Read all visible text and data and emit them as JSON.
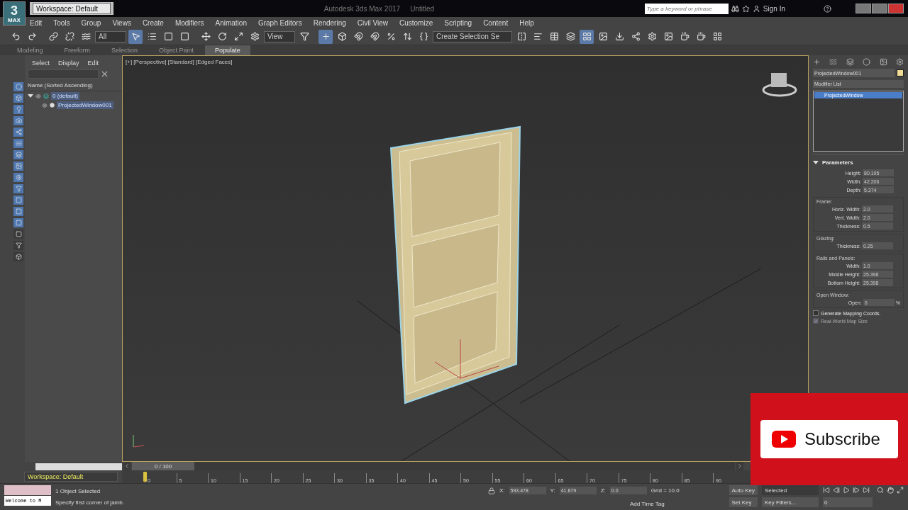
{
  "title_bar": {
    "app_button": {
      "digit": "3",
      "label": "MAX"
    },
    "workspace": "Workspace: Default",
    "title": "Autodesk 3ds Max 2017",
    "document": "Untitled",
    "search": {
      "placeholder": "Type a keyword or phrase"
    },
    "sign_in": "Sign In"
  },
  "menu": [
    "Edit",
    "Tools",
    "Group",
    "Views",
    "Create",
    "Modifiers",
    "Animation",
    "Graph Editors",
    "Rendering",
    "Civil View",
    "Customize",
    "Scripting",
    "Content",
    "Help"
  ],
  "toolbar": {
    "filter": "All",
    "reference": "View",
    "selection_set": "Create Selection Se"
  },
  "ribbon_tabs": [
    {
      "label": "Modeling",
      "selected": false
    },
    {
      "label": "Freeform",
      "selected": false
    },
    {
      "label": "Selection",
      "selected": false
    },
    {
      "label": "Object Paint",
      "selected": false
    },
    {
      "label": "Populate",
      "selected": true
    }
  ],
  "scene_explorer": {
    "tabs": [
      "Select",
      "Display",
      "Edit"
    ],
    "column": "Name (Sorted Ascending)",
    "tree": [
      {
        "label": "0 (default)",
        "expanded": true,
        "selected": true,
        "children": [
          {
            "label": "ProjectedWindow001",
            "selected": true
          }
        ]
      }
    ]
  },
  "viewport": {
    "label": "[+] [Perspective] [Standard] [Edged Faces]"
  },
  "command_panel": {
    "object_name": "ProjectedWindow001",
    "object_swatch": {
      "color": "#f0dc96"
    },
    "modifier_list": "Modifier List",
    "stack": [
      {
        "label": "ProjectedWindow",
        "selected": true
      }
    ],
    "rollout": {
      "title": "Parameters",
      "expanded": true,
      "groups": [
        {
          "rows": [
            {
              "label": "Height:",
              "value": "80.195"
            },
            {
              "label": "Width:",
              "value": "42.206"
            },
            {
              "label": "Depth:",
              "value": "5.374"
            }
          ]
        },
        {
          "title": "Frame:",
          "rows": [
            {
              "label": "Horiz. Width:",
              "value": "2.0"
            },
            {
              "label": "Vert. Width:",
              "value": "2.0"
            },
            {
              "label": "Thickness:",
              "value": "0.5"
            }
          ]
        },
        {
          "title": "Glazing:",
          "rows": [
            {
              "label": "Thickness:",
              "value": "0.25"
            }
          ]
        },
        {
          "title": "Rails and Panels:",
          "rows": [
            {
              "label": "Width:",
              "value": "1.0"
            },
            {
              "label": "Middle Height:",
              "value": "25.398"
            },
            {
              "label": "Bottom Height:",
              "value": "25.398"
            }
          ]
        },
        {
          "title": "Open Window:",
          "rows": [
            {
              "label": "Open:",
              "value": "0",
              "unit": "%"
            }
          ]
        }
      ],
      "options": [
        {
          "label": "Generate Mapping Coords.",
          "checked": false,
          "disabled": false
        },
        {
          "label": "Real-World Map Size",
          "checked": true,
          "disabled": true
        }
      ]
    }
  },
  "timeline": {
    "slider": "0 / 100",
    "level": 0,
    "ticks": [
      "0",
      "5",
      "10",
      "15",
      "20",
      "25",
      "30",
      "35",
      "40",
      "45",
      "50",
      "55",
      "60",
      "65",
      "70",
      "75",
      "80",
      "85",
      "90"
    ]
  },
  "status_bar": {
    "workspace": "Workspace: Default",
    "listener": "Welcome to M",
    "selection": "1 Object Selected",
    "prompt": "Specify first corner of jamb.",
    "coords": [
      {
        "label": "X:",
        "value": "593.478"
      },
      {
        "label": "Y:",
        "value": "41.879"
      },
      {
        "label": "Z:",
        "value": "0.0"
      }
    ],
    "grid": "Grid = 10.0",
    "time_tag": "Add Time Tag",
    "auto_key": "Auto Key",
    "key_mode": "Selected",
    "set_key": "Set Key",
    "key_filters": "Key Filters...",
    "frame": "0"
  },
  "overlay": {
    "label": "Subscribe"
  }
}
